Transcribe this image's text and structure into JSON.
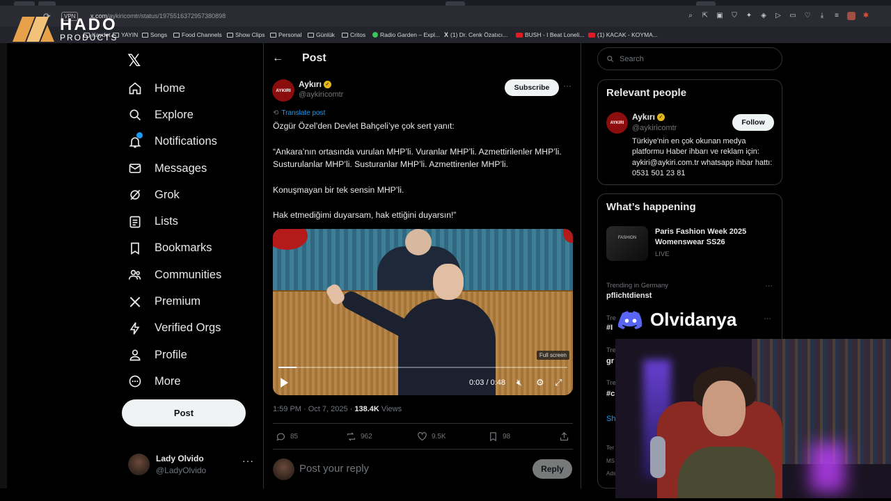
{
  "browser": {
    "url_domain": "x.com",
    "url_path": "/aykiricomtr/status/1975516372957380898",
    "vpn_label": "VPN",
    "bookmarks": [
      {
        "label": "Kaydet",
        "kind": "folder"
      },
      {
        "label": "YAYIN",
        "kind": "folder"
      },
      {
        "label": "Songs",
        "kind": "folder"
      },
      {
        "label": "Food Channels",
        "kind": "folder"
      },
      {
        "label": "Show Clips",
        "kind": "folder"
      },
      {
        "label": "Personal",
        "kind": "folder"
      },
      {
        "label": "Günlük",
        "kind": "folder"
      },
      {
        "label": "Critos",
        "kind": "folder"
      },
      {
        "label": "Radio Garden – Expl...",
        "kind": "site"
      },
      {
        "label": "(1) Dr. Cenk Özatıcı...",
        "kind": "x"
      },
      {
        "label": "BUSH - I Beat Loneli...",
        "kind": "yt"
      },
      {
        "label": "(1) KACAK - KOYMA...",
        "kind": "yt"
      }
    ]
  },
  "overlay_logo": {
    "title": "HADO",
    "subtitle": "PRODUCTS"
  },
  "sidebar": {
    "items": [
      {
        "label": "Home",
        "icon": "home-icon"
      },
      {
        "label": "Explore",
        "icon": "search-icon"
      },
      {
        "label": "Notifications",
        "icon": "bell-icon"
      },
      {
        "label": "Messages",
        "icon": "mail-icon"
      },
      {
        "label": "Grok",
        "icon": "grok-icon"
      },
      {
        "label": "Lists",
        "icon": "list-icon"
      },
      {
        "label": "Bookmarks",
        "icon": "bookmark-icon"
      },
      {
        "label": "Communities",
        "icon": "people-icon"
      },
      {
        "label": "Premium",
        "icon": "x-icon"
      },
      {
        "label": "Verified Orgs",
        "icon": "lightning-icon"
      },
      {
        "label": "Profile",
        "icon": "person-icon"
      },
      {
        "label": "More",
        "icon": "more-circle-icon"
      }
    ],
    "post_label": "Post",
    "account": {
      "name": "Lady Olvido",
      "handle": "@LadyOlvido"
    }
  },
  "main": {
    "title": "Post",
    "author": {
      "name": "Aykırı",
      "handle": "@aykiricomtr",
      "avatar_text": "AYKIRI"
    },
    "subscribe_label": "Subscribe",
    "translate_label": "Translate post",
    "paragraphs": [
      "Özgür Özel’den Devlet Bahçeli’ye çok sert yanıt:",
      "“Ankara’nın ortasında vurulan MHP’li. Vuranlar MHP’li. Azmettirilenler MHP’li. Susturulanlar MHP’li. Susturanlar MHP’li. Azmettirenler MHP’li.",
      "Konuşmayan bir tek sensin MHP’li.",
      "Hak etmediğimi duyarsam, hak ettiğini duyarsın!”"
    ],
    "video": {
      "time": "0:03 / 0:48",
      "fullscreen_tip": "Full screen",
      "progress_fraction": 0.0625
    },
    "meta": {
      "time": "1:59 PM · Oct 7, 2025 · ",
      "views": "138.4K",
      "views_label": " Views"
    },
    "stats": {
      "replies": "85",
      "reposts": "962",
      "likes": "9.5K",
      "bookmarks": "98"
    },
    "reply_placeholder": "Post your reply",
    "reply_label": "Reply"
  },
  "right": {
    "search_placeholder": "Search",
    "relevant": {
      "title": "Relevant people",
      "name": "Aykırı",
      "handle": "@aykiricomtr",
      "follow_label": "Follow",
      "bio": "Türkiye'nin en çok okunan medya platformu Haber ihbarı ve reklam için: aykiri@aykiri.com.tr whatsapp ihbar hattı: 0531 501 23 81"
    },
    "happening": {
      "title": "What’s happening",
      "featured": {
        "title": "Paris Fashion Week 2025 Womenswear SS26",
        "status": "LIVE",
        "img_text": "FASHION"
      },
      "trend": {
        "context": "Trending in Germany",
        "name": "pflichtdienst"
      },
      "partials": [
        "Tre",
        "#I",
        "Tre",
        "gr",
        "Tre",
        "#c",
        "Sh"
      ]
    },
    "footer_partials": [
      "Ter",
      "MS",
      "Ads"
    ]
  },
  "stream": {
    "discord_name": "Olvidanya"
  },
  "colors": {
    "accent": "#1d9bf0",
    "background": "#000000",
    "verified": "#e2b719",
    "aykiri_red": "#8b0d0d"
  }
}
